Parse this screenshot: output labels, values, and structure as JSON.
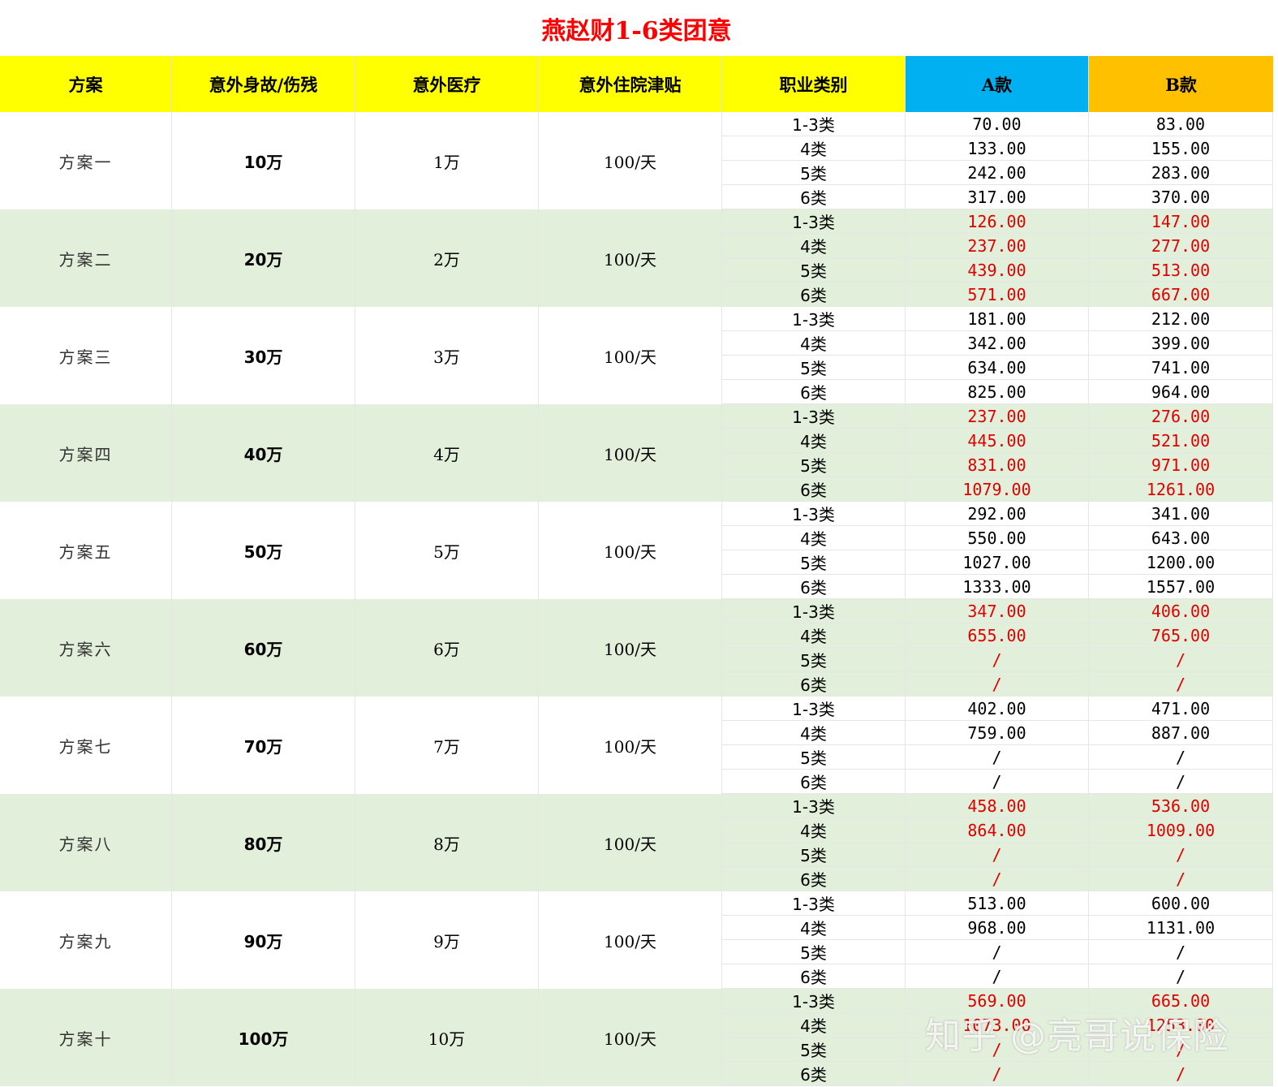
{
  "title": "燕赵财1-6类团意",
  "headers": [
    "方案",
    "意外身故/伤残",
    "意外医疗",
    "意外住院津贴",
    "职业类别",
    "A款",
    "B款"
  ],
  "colors": {
    "header_yellow": "#ffff00",
    "header_blue": "#00b0f0",
    "header_orange": "#ffc000",
    "row_green": "#e2efda",
    "red_text": "#e00000",
    "title_red": "#ff0000"
  },
  "plans": [
    {
      "name": "方案一",
      "death": "10万",
      "medical": "1万",
      "allowance": "100/天",
      "shaded": false,
      "red": false,
      "rows": [
        {
          "occ": "1-3类",
          "a": "70.00",
          "b": "83.00"
        },
        {
          "occ": "4类",
          "a": "133.00",
          "b": "155.00"
        },
        {
          "occ": "5类",
          "a": "242.00",
          "b": "283.00"
        },
        {
          "occ": "6类",
          "a": "317.00",
          "b": "370.00"
        }
      ]
    },
    {
      "name": "方案二",
      "death": "20万",
      "medical": "2万",
      "allowance": "100/天",
      "shaded": true,
      "red": true,
      "rows": [
        {
          "occ": "1-3类",
          "a": "126.00",
          "b": "147.00"
        },
        {
          "occ": "4类",
          "a": "237.00",
          "b": "277.00"
        },
        {
          "occ": "5类",
          "a": "439.00",
          "b": "513.00"
        },
        {
          "occ": "6类",
          "a": "571.00",
          "b": "667.00"
        }
      ]
    },
    {
      "name": "方案三",
      "death": "30万",
      "medical": "3万",
      "allowance": "100/天",
      "shaded": false,
      "red": false,
      "rows": [
        {
          "occ": "1-3类",
          "a": "181.00",
          "b": "212.00"
        },
        {
          "occ": "4类",
          "a": "342.00",
          "b": "399.00"
        },
        {
          "occ": "5类",
          "a": "634.00",
          "b": "741.00"
        },
        {
          "occ": "6类",
          "a": "825.00",
          "b": "964.00"
        }
      ]
    },
    {
      "name": "方案四",
      "death": "40万",
      "medical": "4万",
      "allowance": "100/天",
      "shaded": true,
      "red": true,
      "rows": [
        {
          "occ": "1-3类",
          "a": "237.00",
          "b": "276.00"
        },
        {
          "occ": "4类",
          "a": "445.00",
          "b": "521.00"
        },
        {
          "occ": "5类",
          "a": "831.00",
          "b": "971.00"
        },
        {
          "occ": "6类",
          "a": "1079.00",
          "b": "1261.00"
        }
      ]
    },
    {
      "name": "方案五",
      "death": "50万",
      "medical": "5万",
      "allowance": "100/天",
      "shaded": false,
      "red": false,
      "rows": [
        {
          "occ": "1-3类",
          "a": "292.00",
          "b": "341.00"
        },
        {
          "occ": "4类",
          "a": "550.00",
          "b": "643.00"
        },
        {
          "occ": "5类",
          "a": "1027.00",
          "b": "1200.00"
        },
        {
          "occ": "6类",
          "a": "1333.00",
          "b": "1557.00"
        }
      ]
    },
    {
      "name": "方案六",
      "death": "60万",
      "medical": "6万",
      "allowance": "100/天",
      "shaded": true,
      "red": true,
      "rows": [
        {
          "occ": "1-3类",
          "a": "347.00",
          "b": "406.00"
        },
        {
          "occ": "4类",
          "a": "655.00",
          "b": "765.00"
        },
        {
          "occ": "5类",
          "a": "/",
          "b": "/"
        },
        {
          "occ": "6类",
          "a": "/",
          "b": "/"
        }
      ]
    },
    {
      "name": "方案七",
      "death": "70万",
      "medical": "7万",
      "allowance": "100/天",
      "shaded": false,
      "red": false,
      "rows": [
        {
          "occ": "1-3类",
          "a": "402.00",
          "b": "471.00"
        },
        {
          "occ": "4类",
          "a": "759.00",
          "b": "887.00"
        },
        {
          "occ": "5类",
          "a": "/",
          "b": "/"
        },
        {
          "occ": "6类",
          "a": "/",
          "b": "/"
        }
      ]
    },
    {
      "name": "方案八",
      "death": "80万",
      "medical": "8万",
      "allowance": "100/天",
      "shaded": true,
      "red": true,
      "rows": [
        {
          "occ": "1-3类",
          "a": "458.00",
          "b": "536.00"
        },
        {
          "occ": "4类",
          "a": "864.00",
          "b": "1009.00"
        },
        {
          "occ": "5类",
          "a": "/",
          "b": "/"
        },
        {
          "occ": "6类",
          "a": "/",
          "b": "/"
        }
      ]
    },
    {
      "name": "方案九",
      "death": "90万",
      "medical": "9万",
      "allowance": "100/天",
      "shaded": false,
      "red": false,
      "rows": [
        {
          "occ": "1-3类",
          "a": "513.00",
          "b": "600.00"
        },
        {
          "occ": "4类",
          "a": "968.00",
          "b": "1131.00"
        },
        {
          "occ": "5类",
          "a": "/",
          "b": "/"
        },
        {
          "occ": "6类",
          "a": "/",
          "b": "/"
        }
      ]
    },
    {
      "name": "方案十",
      "death": "100万",
      "medical": "10万",
      "allowance": "100/天",
      "shaded": true,
      "red": true,
      "rows": [
        {
          "occ": "1-3类",
          "a": "569.00",
          "b": "665.00"
        },
        {
          "occ": "4类",
          "a": "1073.00",
          "b": "1253.00"
        },
        {
          "occ": "5类",
          "a": "/",
          "b": "/"
        },
        {
          "occ": "6类",
          "a": "/",
          "b": "/"
        }
      ]
    }
  ],
  "watermark": "知乎 @亮哥说保险"
}
